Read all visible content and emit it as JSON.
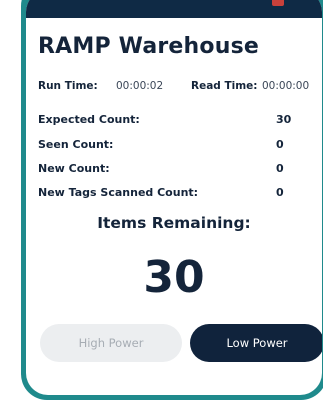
{
  "app": {
    "title": "RAMP Warehouse"
  },
  "timers": {
    "run_time_label": "Run Time:",
    "run_time_value": "00:00:02",
    "read_time_label": "Read Time:",
    "read_time_value": "00:00:00"
  },
  "counts": [
    {
      "label": "Expected Count:",
      "value": "30"
    },
    {
      "label": "Seen Count:",
      "value": "0"
    },
    {
      "label": "New Count:",
      "value": "0"
    },
    {
      "label": "New Tags Scanned Count:",
      "value": "0"
    }
  ],
  "remaining": {
    "label": "Items Remaining:",
    "value": "30"
  },
  "buttons": {
    "high_power": "High Power",
    "low_power": "Low Power"
  },
  "colors": {
    "frame": "#1f8a8c",
    "header_bar": "#0f2a45",
    "text": "#14243a",
    "low_power_bg": "#10233c",
    "high_power_bg": "#eceef0"
  }
}
